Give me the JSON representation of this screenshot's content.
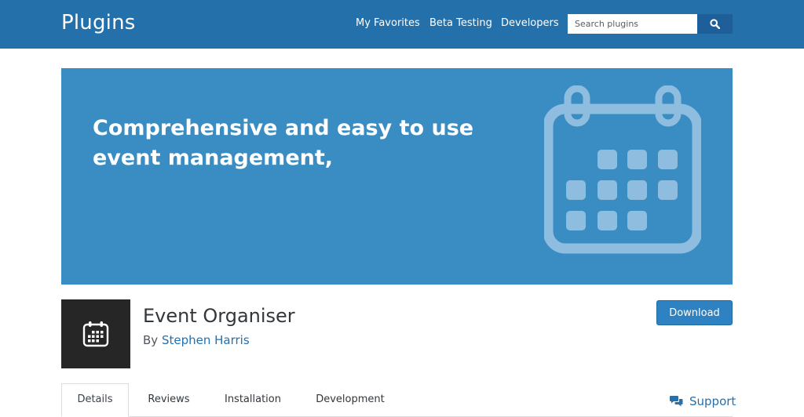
{
  "header": {
    "brand": "Plugins",
    "nav": [
      "My Favorites",
      "Beta Testing",
      "Developers"
    ],
    "search_placeholder": "Search plugins",
    "search_icon": "search-icon"
  },
  "banner": {
    "line1": "Comprehensive and easy to use",
    "line2": "event management,",
    "icon": "calendar-icon"
  },
  "plugin": {
    "icon": "calendar-icon",
    "title": "Event Organiser",
    "by": "By",
    "author": "Stephen Harris",
    "download_label": "Download"
  },
  "tabs": [
    "Details",
    "Reviews",
    "Installation",
    "Development"
  ],
  "support": {
    "label": "Support",
    "icon": "speech-bubbles-icon"
  },
  "colors": {
    "header": "#2470aa",
    "banner": "#3a8dc3",
    "accent": "#2271b1",
    "download": "#2e82c2"
  }
}
